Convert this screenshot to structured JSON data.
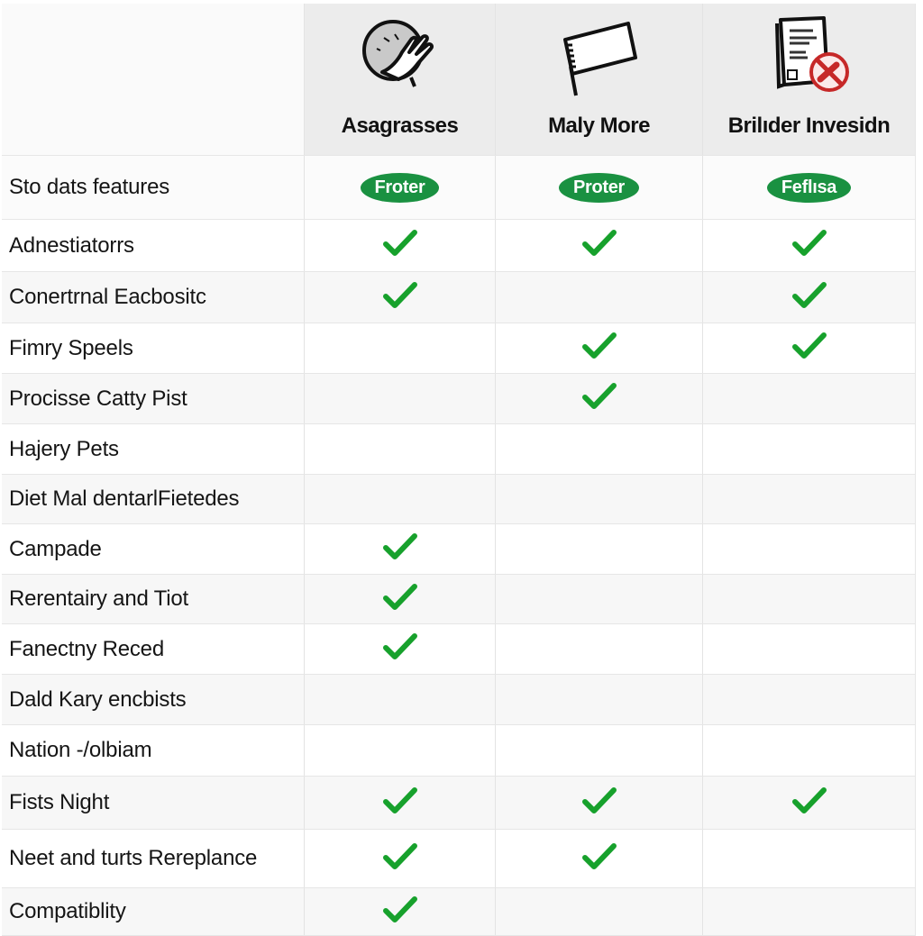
{
  "colors": {
    "accent": "#1a9141",
    "check": "#17a12c",
    "header_bg": "#ececec",
    "no_entry": "#c62828"
  },
  "columns": [
    {
      "title": "Asagrasses",
      "icon": "hand-wiping-plate-icon",
      "badge": "Froter"
    },
    {
      "title": "Maly More",
      "icon": "flag-icon",
      "badge": "Proter"
    },
    {
      "title": "Brilıder Invesidn",
      "icon": "document-no-entry-icon",
      "badge": "Feflısa"
    }
  ],
  "badge_row_label": "Sto dats features",
  "rows": [
    {
      "feature": "Adnestiatorrs",
      "checks": [
        true,
        true,
        true
      ]
    },
    {
      "feature": "Conertrnal Eacbositc",
      "checks": [
        true,
        false,
        true
      ]
    },
    {
      "feature": "Fimry Speels",
      "checks": [
        false,
        true,
        true
      ]
    },
    {
      "feature": "Procisse Catty Pist",
      "checks": [
        false,
        true,
        false
      ]
    },
    {
      "feature": "Hajery Pets",
      "checks": [
        false,
        false,
        false
      ]
    },
    {
      "feature": "Diet Mal dentarlFietedes",
      "checks": [
        false,
        false,
        false
      ]
    },
    {
      "feature": "Campade",
      "checks": [
        true,
        false,
        false
      ]
    },
    {
      "feature": "Rerentairy and Tiot",
      "checks": [
        true,
        false,
        false
      ]
    },
    {
      "feature": "Fanectny Reced",
      "checks": [
        true,
        false,
        false
      ]
    },
    {
      "feature": "Dald Kary encbists",
      "checks": [
        false,
        false,
        false
      ]
    },
    {
      "feature": "Nation -/olbiam",
      "checks": [
        false,
        false,
        false
      ]
    },
    {
      "feature": "Fists Night",
      "checks": [
        true,
        true,
        true
      ]
    },
    {
      "feature": "Neet and turts Rereplance",
      "checks": [
        true,
        true,
        false
      ]
    },
    {
      "feature": "Compatiblity",
      "checks": [
        true,
        false,
        false
      ]
    }
  ]
}
